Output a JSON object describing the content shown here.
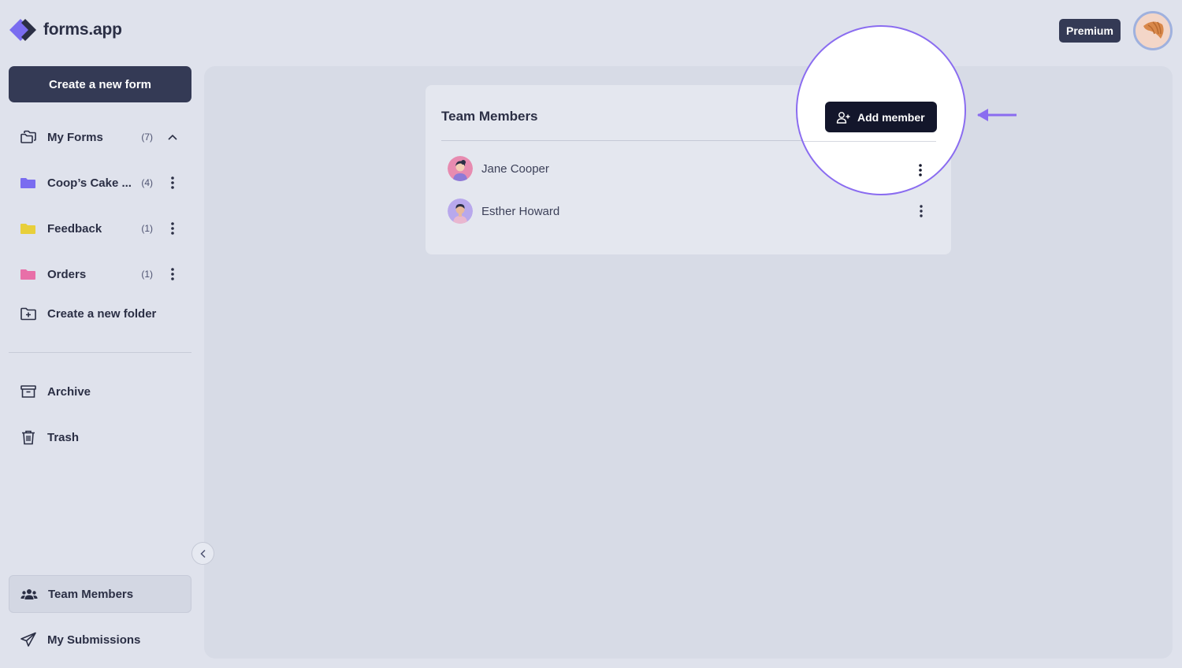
{
  "app": {
    "logo_text": "forms.app",
    "premium_label": "Premium"
  },
  "colors": {
    "accent": "#8a6cf0",
    "dark": "#343a55",
    "button_dark": "#13162b",
    "background": "#dfe2ec"
  },
  "sidebar": {
    "create_form_label": "Create a new form",
    "my_forms": {
      "label": "My Forms",
      "count": "(7)",
      "icon": "folders-icon"
    },
    "folders": [
      {
        "label": "Coop’s Cake ...",
        "count": "(4)",
        "color": "#7a6cf0"
      },
      {
        "label": "Feedback",
        "count": "(1)",
        "color": "#e8cf3a"
      },
      {
        "label": "Orders",
        "count": "(1)",
        "color": "#e86fa8"
      }
    ],
    "create_folder_label": "Create a new folder",
    "archive_label": "Archive",
    "trash_label": "Trash",
    "team_members_label": "Team Members",
    "my_submissions_label": "My Submissions"
  },
  "main": {
    "card_title": "Team Members",
    "add_member_label": "Add member",
    "members": [
      {
        "name": "Jane Cooper"
      },
      {
        "name": "Esther Howard"
      }
    ]
  }
}
